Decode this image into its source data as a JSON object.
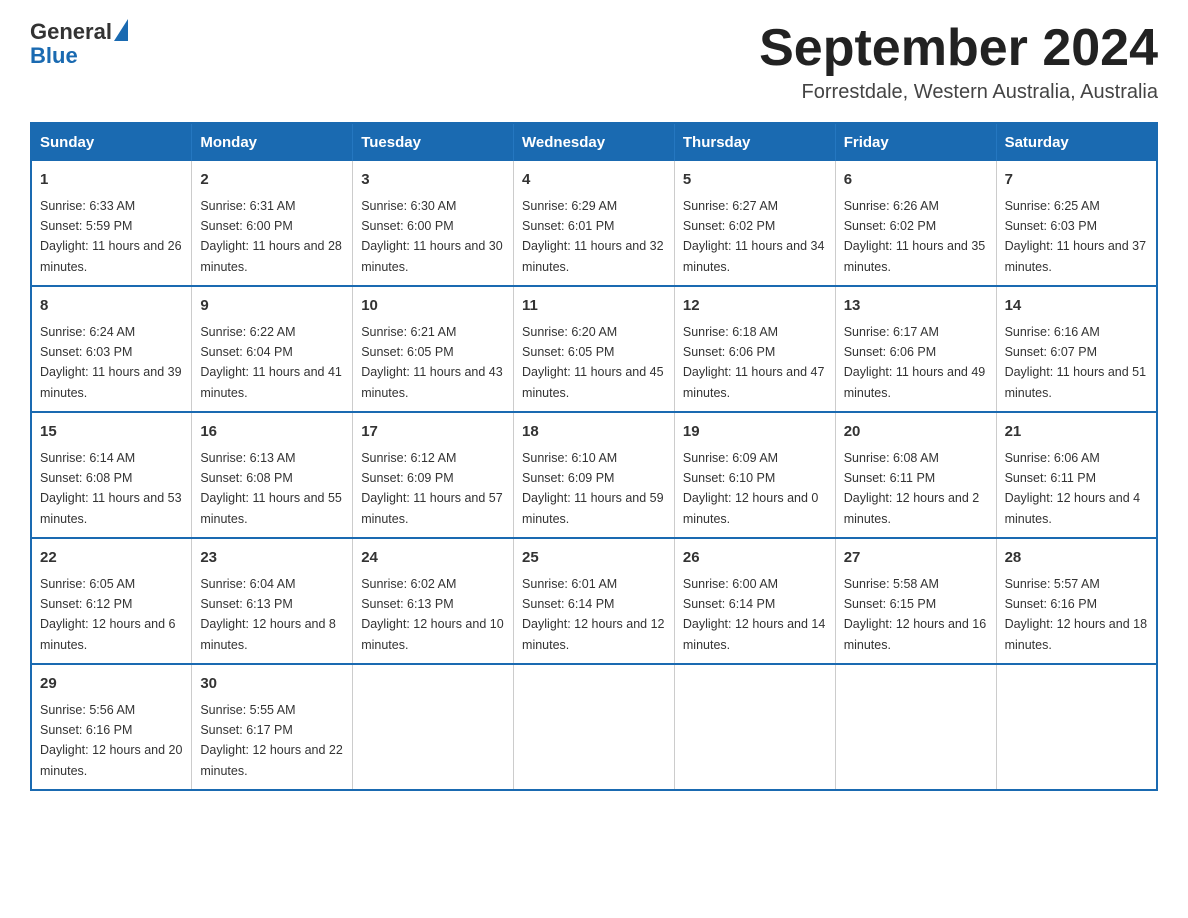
{
  "logo": {
    "text_general": "General",
    "text_blue": "Blue",
    "triangle_label": "logo-triangle"
  },
  "header": {
    "month_title": "September 2024",
    "location": "Forrestdale, Western Australia, Australia"
  },
  "weekdays": [
    "Sunday",
    "Monday",
    "Tuesday",
    "Wednesday",
    "Thursday",
    "Friday",
    "Saturday"
  ],
  "weeks": [
    [
      {
        "day": "1",
        "sunrise": "6:33 AM",
        "sunset": "5:59 PM",
        "daylight": "11 hours and 26 minutes."
      },
      {
        "day": "2",
        "sunrise": "6:31 AM",
        "sunset": "6:00 PM",
        "daylight": "11 hours and 28 minutes."
      },
      {
        "day": "3",
        "sunrise": "6:30 AM",
        "sunset": "6:00 PM",
        "daylight": "11 hours and 30 minutes."
      },
      {
        "day": "4",
        "sunrise": "6:29 AM",
        "sunset": "6:01 PM",
        "daylight": "11 hours and 32 minutes."
      },
      {
        "day": "5",
        "sunrise": "6:27 AM",
        "sunset": "6:02 PM",
        "daylight": "11 hours and 34 minutes."
      },
      {
        "day": "6",
        "sunrise": "6:26 AM",
        "sunset": "6:02 PM",
        "daylight": "11 hours and 35 minutes."
      },
      {
        "day": "7",
        "sunrise": "6:25 AM",
        "sunset": "6:03 PM",
        "daylight": "11 hours and 37 minutes."
      }
    ],
    [
      {
        "day": "8",
        "sunrise": "6:24 AM",
        "sunset": "6:03 PM",
        "daylight": "11 hours and 39 minutes."
      },
      {
        "day": "9",
        "sunrise": "6:22 AM",
        "sunset": "6:04 PM",
        "daylight": "11 hours and 41 minutes."
      },
      {
        "day": "10",
        "sunrise": "6:21 AM",
        "sunset": "6:05 PM",
        "daylight": "11 hours and 43 minutes."
      },
      {
        "day": "11",
        "sunrise": "6:20 AM",
        "sunset": "6:05 PM",
        "daylight": "11 hours and 45 minutes."
      },
      {
        "day": "12",
        "sunrise": "6:18 AM",
        "sunset": "6:06 PM",
        "daylight": "11 hours and 47 minutes."
      },
      {
        "day": "13",
        "sunrise": "6:17 AM",
        "sunset": "6:06 PM",
        "daylight": "11 hours and 49 minutes."
      },
      {
        "day": "14",
        "sunrise": "6:16 AM",
        "sunset": "6:07 PM",
        "daylight": "11 hours and 51 minutes."
      }
    ],
    [
      {
        "day": "15",
        "sunrise": "6:14 AM",
        "sunset": "6:08 PM",
        "daylight": "11 hours and 53 minutes."
      },
      {
        "day": "16",
        "sunrise": "6:13 AM",
        "sunset": "6:08 PM",
        "daylight": "11 hours and 55 minutes."
      },
      {
        "day": "17",
        "sunrise": "6:12 AM",
        "sunset": "6:09 PM",
        "daylight": "11 hours and 57 minutes."
      },
      {
        "day": "18",
        "sunrise": "6:10 AM",
        "sunset": "6:09 PM",
        "daylight": "11 hours and 59 minutes."
      },
      {
        "day": "19",
        "sunrise": "6:09 AM",
        "sunset": "6:10 PM",
        "daylight": "12 hours and 0 minutes."
      },
      {
        "day": "20",
        "sunrise": "6:08 AM",
        "sunset": "6:11 PM",
        "daylight": "12 hours and 2 minutes."
      },
      {
        "day": "21",
        "sunrise": "6:06 AM",
        "sunset": "6:11 PM",
        "daylight": "12 hours and 4 minutes."
      }
    ],
    [
      {
        "day": "22",
        "sunrise": "6:05 AM",
        "sunset": "6:12 PM",
        "daylight": "12 hours and 6 minutes."
      },
      {
        "day": "23",
        "sunrise": "6:04 AM",
        "sunset": "6:13 PM",
        "daylight": "12 hours and 8 minutes."
      },
      {
        "day": "24",
        "sunrise": "6:02 AM",
        "sunset": "6:13 PM",
        "daylight": "12 hours and 10 minutes."
      },
      {
        "day": "25",
        "sunrise": "6:01 AM",
        "sunset": "6:14 PM",
        "daylight": "12 hours and 12 minutes."
      },
      {
        "day": "26",
        "sunrise": "6:00 AM",
        "sunset": "6:14 PM",
        "daylight": "12 hours and 14 minutes."
      },
      {
        "day": "27",
        "sunrise": "5:58 AM",
        "sunset": "6:15 PM",
        "daylight": "12 hours and 16 minutes."
      },
      {
        "day": "28",
        "sunrise": "5:57 AM",
        "sunset": "6:16 PM",
        "daylight": "12 hours and 18 minutes."
      }
    ],
    [
      {
        "day": "29",
        "sunrise": "5:56 AM",
        "sunset": "6:16 PM",
        "daylight": "12 hours and 20 minutes."
      },
      {
        "day": "30",
        "sunrise": "5:55 AM",
        "sunset": "6:17 PM",
        "daylight": "12 hours and 22 minutes."
      },
      null,
      null,
      null,
      null,
      null
    ]
  ],
  "labels": {
    "sunrise": "Sunrise:",
    "sunset": "Sunset:",
    "daylight": "Daylight:"
  }
}
